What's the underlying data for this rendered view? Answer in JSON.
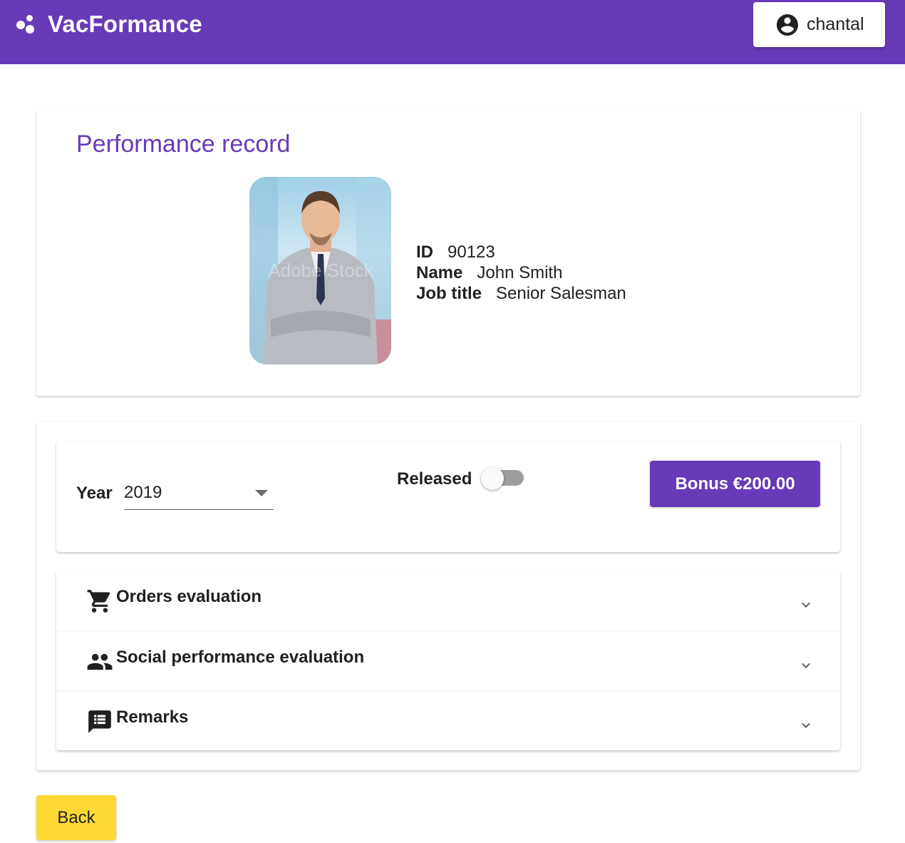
{
  "header": {
    "brand_name": "VacFormance",
    "user_name": "chantal",
    "user_icon": "account-circle-icon"
  },
  "profile": {
    "title": "Performance record",
    "fields": [
      {
        "label": "ID",
        "value": "90123"
      },
      {
        "label": "Name",
        "value": "John Smith"
      },
      {
        "label": "Job title",
        "value": "Senior Salesman"
      }
    ]
  },
  "filters": {
    "year_label": "Year",
    "year_value": "2019",
    "released_label": "Released",
    "released_on": false,
    "bonus_label": "Bonus €200.00"
  },
  "sections": [
    {
      "title": "Orders evaluation",
      "icon": "shopping-cart-icon"
    },
    {
      "title": "Social performance evaluation",
      "icon": "people-icon"
    },
    {
      "title": "Remarks",
      "icon": "comment-list-icon"
    }
  ],
  "back_label": "Back",
  "colors": {
    "primary": "#673ab7",
    "back_button": "#fdd835",
    "toggle_off": "#9e9e9e"
  }
}
